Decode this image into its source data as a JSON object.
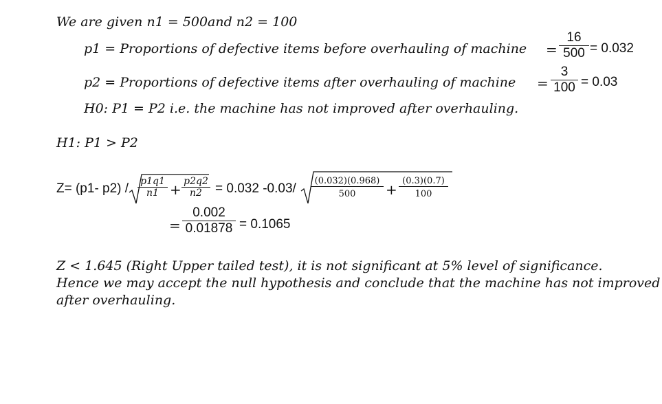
{
  "given": {
    "text": "We are given n1 = 500and n2 = 100"
  },
  "p1": {
    "lhs": "p1 = ",
    "desc": "Proportions of defective items before overhauling of machine",
    "eq": "=",
    "num": "16",
    "den": "500",
    "result": "= 0.032"
  },
  "p2": {
    "lhs": "p2 = ",
    "desc": "Proportions of defective items after overhauling of machine",
    "eq": "=",
    "num": "3",
    "den": "100",
    "result": "= 0.03"
  },
  "h0": {
    "text": "H0: P1 = P2 i.e. the machine has not improved after overhauling."
  },
  "h1": {
    "text": "H1: P1 > P2"
  },
  "z": {
    "lhs": "Z= (p1- p2) /",
    "t1_num": "p1q1",
    "t1_den": "n1",
    "plus": "+",
    "t2_num": "p2q2",
    "t2_den": "n2",
    "mid": "= 0.032 -0.03/",
    "s1_num": "(0.032)(0.968)",
    "s1_den": "500",
    "s2_num": "(0.3)(0.7)",
    "s2_den": "100",
    "eq2": "=",
    "f_num": "0.002",
    "f_den": "0.01878",
    "result": "= 0.1065"
  },
  "conclusion": {
    "line1": "Z < 1.645 (Right Upper tailed test), it is not significant at 5% level of significance.",
    "line2": " Hence we may accept the null hypothesis and conclude that the machine has not improved",
    "line3": "after overhauling."
  }
}
